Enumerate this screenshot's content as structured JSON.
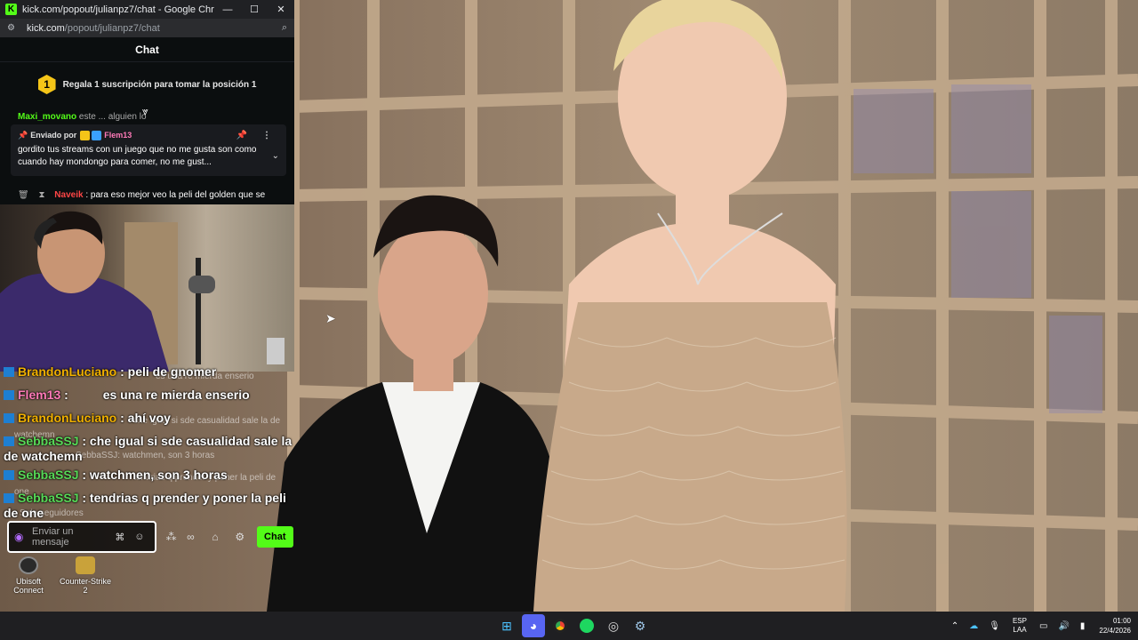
{
  "window": {
    "title": "kick.com/popout/julianpz7/chat - Google Chrome",
    "logo": "K",
    "minimize": "—",
    "maximize": "☐",
    "close": "✕",
    "url_host": "kick.com",
    "url_path": "/popout/julianpz7/chat"
  },
  "chat_panel": {
    "header": "Chat",
    "sub_banner": "Regala 1 suscripción para tomar la posición 1",
    "rank": "1",
    "top_row_user": "Maxi_movano",
    "top_row_msg": "este ... alguien lo",
    "pinned": {
      "sent_by": "Enviado por",
      "user": "Flem13",
      "message": "gordito tus streams con un juego que no me gusta son como cuando hay mondongo para comer, no me gust..."
    },
    "bottom_row_user": "Naveik",
    "bottom_row_msg": ": para eso mejor veo la peli del golden que se"
  },
  "overlay_chat": [
    {
      "user": "BrandonLuciano",
      "msg": ": peli de gnomer",
      "color": "name-y"
    },
    {
      "user": "Flem13",
      "msg": ":          es una re mierda enserio",
      "color": "name-p"
    },
    {
      "user": "BrandonLuciano",
      "msg": ": ahí voy",
      "color": "name-y"
    },
    {
      "user": "SebbaSSJ",
      "msg": ": che igual si sde casualidad sale la de watchemn",
      "color": "name-g"
    },
    {
      "user": "SebbaSSJ",
      "msg": ": watchmen, son 3 horas",
      "color": "name-g"
    },
    {
      "user": "SebbaSSJ",
      "msg": ": tendrias q prender y poner la peli de one",
      "color": "name-g"
    }
  ],
  "ghost_text": {
    "g1": "es una re mierda enserio",
    "g2": "che igual si sde casualidad sale la de",
    "g3": "watchemn",
    "g4": "SebbaSSJ: watchmen, son 3 horas",
    "g5": "tendrias q prender y poner la peli de",
    "g6": "one",
    "g7": "Solo seguidores"
  },
  "chat_input": {
    "placeholder_line1": "Enviar un",
    "placeholder_line2": "mensaje",
    "send_label": "Chat"
  },
  "desktop_icons": [
    {
      "label": "Ubisoft Connect"
    },
    {
      "label": "Counter-Strike 2"
    }
  ],
  "taskbar": {
    "lang_line1": "ESP",
    "lang_line2": "LAA",
    "time": "01:00",
    "date": "22/4/2026"
  },
  "colors": {
    "kick_green": "#53fc18",
    "taskbar_bg": "#1f1f22",
    "chat_bg": "#0b0e0f"
  }
}
